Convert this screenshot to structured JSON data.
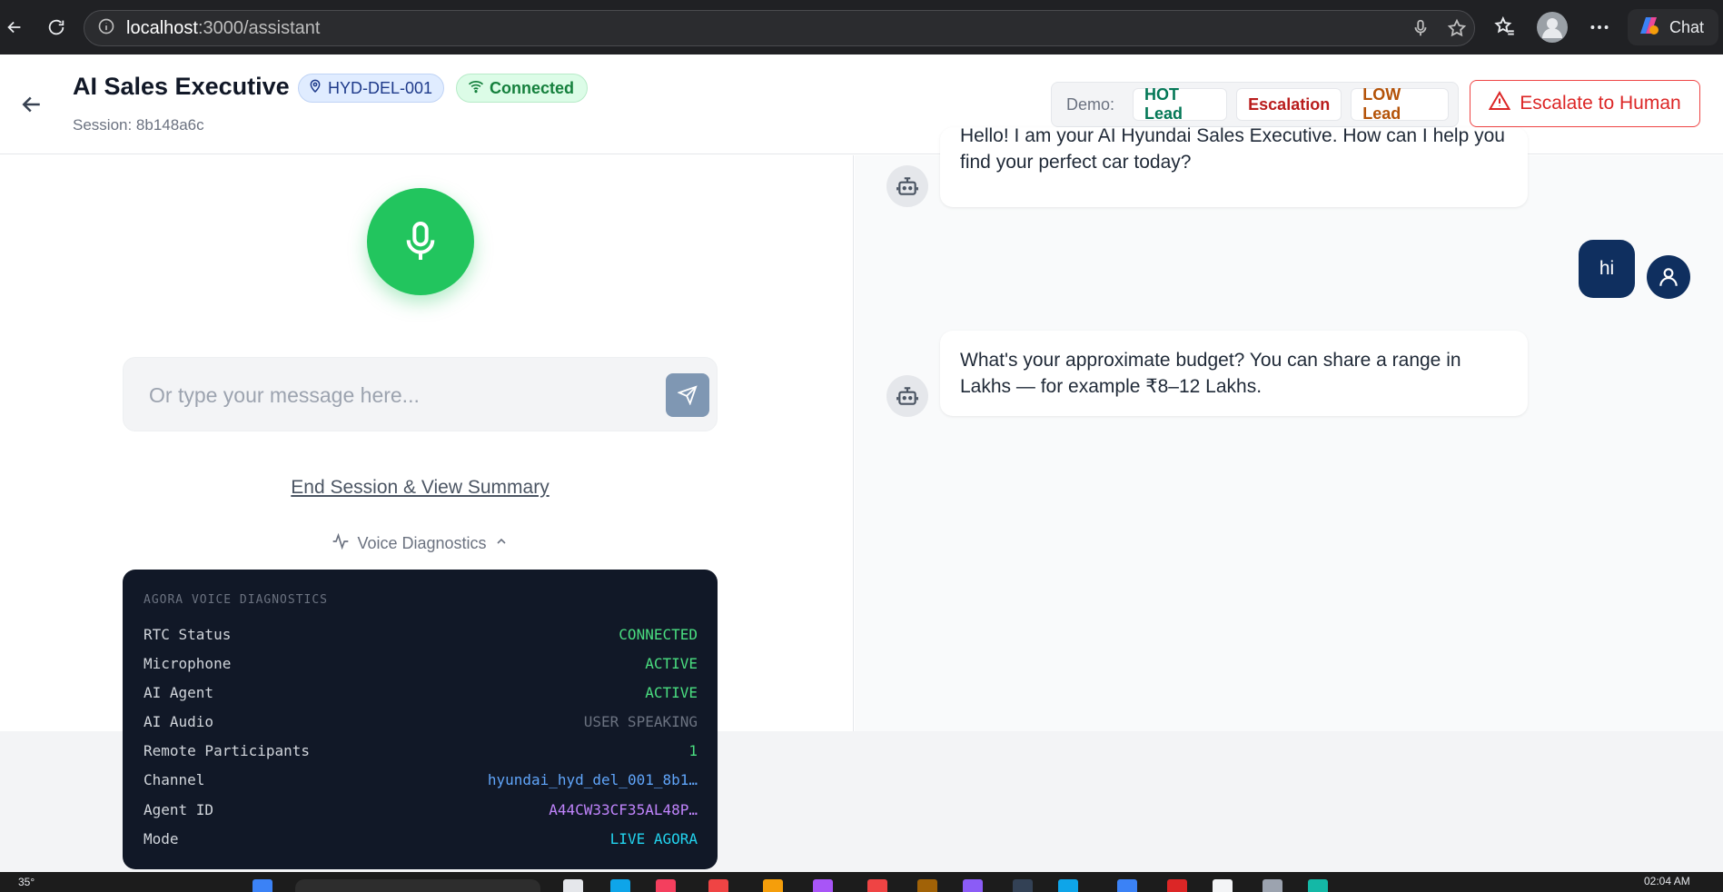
{
  "browser": {
    "url_host": "localhost",
    "url_path": ":3000/assistant",
    "chat_label": "Chat"
  },
  "header": {
    "title": "AI Sales Executive",
    "location_code": "HYD-DEL-001",
    "connection_status": "Connected",
    "session_label": "Session: 8b148a6c",
    "demo_label": "Demo:",
    "demo_buttons": [
      "HOT Lead",
      "Escalation",
      "LOW Lead"
    ],
    "escalate_label": "Escalate to Human"
  },
  "composer": {
    "placeholder": "Or type your message here...",
    "end_session_label": "End Session & View Summary",
    "diagnostics_toggle": "Voice Diagnostics"
  },
  "diagnostics": {
    "title": "AGORA VOICE DIAGNOSTICS",
    "rows": [
      {
        "key": "RTC Status",
        "value": "CONNECTED",
        "color": "#4ade80"
      },
      {
        "key": "Microphone",
        "value": "ACTIVE",
        "color": "#4ade80"
      },
      {
        "key": "AI Agent",
        "value": "ACTIVE",
        "color": "#4ade80"
      },
      {
        "key": "AI Audio",
        "value": "USER SPEAKING",
        "color": "#6b7280"
      },
      {
        "key": "Remote Participants",
        "value": "1",
        "color": "#4ade80"
      },
      {
        "key": "Channel",
        "value": "hyundai_hyd_del_001_8b1…",
        "color": "#60a5fa"
      },
      {
        "key": "Agent ID",
        "value": "A44CW33CF35AL48P…",
        "color": "#c084fc"
      },
      {
        "key": "Mode",
        "value": "LIVE AGORA",
        "color": "#22d3ee"
      }
    ]
  },
  "chat": {
    "messages": [
      {
        "role": "assistant",
        "text": "Hello! I am your AI Hyundai Sales Executive. How can I help you find your perfect car today?"
      },
      {
        "role": "user",
        "text": "hi"
      },
      {
        "role": "assistant",
        "text": "What's your approximate budget? You can share a range in Lakhs — for example ₹8–12 Lakhs."
      }
    ]
  },
  "taskbar": {
    "temperature": "35°",
    "time": "02:04 AM"
  },
  "colors": {
    "mic_green": "#22c55e",
    "user_navy": "#0f2f5f",
    "escalate_red": "#dc2626",
    "diag_bg": "#111827"
  }
}
